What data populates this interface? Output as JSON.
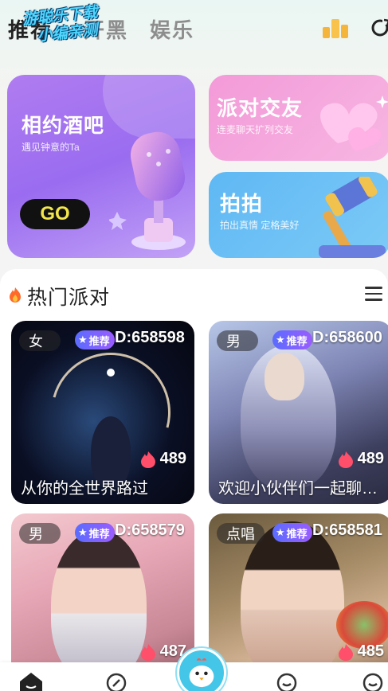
{
  "topnav": {
    "tabs": [
      {
        "label": "推荐",
        "active": true
      },
      {
        "label": "开黑",
        "active": false
      },
      {
        "label": "娱乐",
        "active": false
      }
    ],
    "watermark_line1": "游聪乐下载",
    "watermark_line2": "小编亲测",
    "rank_icon": "ranking-bars-icon",
    "refresh_icon": "refresh-icon"
  },
  "cards": {
    "bar": {
      "title": "相约酒吧",
      "subtitle": "遇见钟意的Ta",
      "button": "GO"
    },
    "party": {
      "title": "派对交友",
      "subtitle": "连麦聊天扩列交友"
    },
    "snap": {
      "title": "拍拍",
      "subtitle": "拍出真情 定格美好"
    }
  },
  "section": {
    "title": "热门派对",
    "hot_icon": "hot-flame-icon",
    "menu_icon": "menu-icon"
  },
  "rooms": [
    {
      "gender": "女",
      "badge": "推荐",
      "id_text": "D:658598",
      "heat": "489",
      "name": "从你的全世界路过"
    },
    {
      "gender": "男",
      "badge": "推荐",
      "id_text": "D:658600",
      "heat": "489",
      "name": "欢迎小伙伴们一起聊…"
    },
    {
      "gender": "男",
      "badge": "推荐",
      "id_text": "D:658579",
      "heat": "487",
      "name": ""
    },
    {
      "gender": "点唱",
      "badge": "推荐",
      "id_text": "D:658581",
      "heat": "485",
      "name": ""
    }
  ],
  "bottomnav": {
    "items": [
      "home-icon",
      "discover-icon",
      "center-mascot-icon",
      "message-icon",
      "profile-icon"
    ]
  },
  "colors": {
    "accent_purple": "#9a6cf0",
    "accent_pink": "#f39ad8",
    "accent_blue": "#5fb8f4",
    "go_text": "#f2e64a",
    "heat_flame": "#ff4f6a"
  }
}
